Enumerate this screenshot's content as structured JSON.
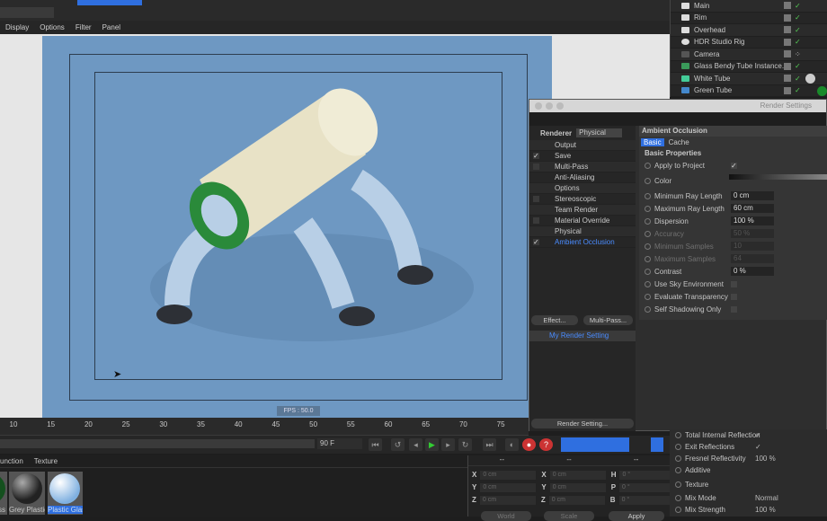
{
  "menubar": [
    "Display",
    "Options",
    "Filter",
    "Panel"
  ],
  "objects": [
    {
      "name": "Main",
      "check": true
    },
    {
      "name": "Rim",
      "check": true
    },
    {
      "name": "Overhead",
      "check": true
    },
    {
      "name": "HDR Studio Rig",
      "check": true
    },
    {
      "name": "Camera",
      "check": false
    },
    {
      "name": "Glass Bendy Tube Instance.1",
      "check": true
    },
    {
      "name": "White Tube",
      "check": true
    },
    {
      "name": "Green Tube",
      "check": true
    }
  ],
  "viewport": {
    "fps": "FPS : 50.0"
  },
  "render_settings": {
    "title": "Render Settings",
    "renderer_label": "Renderer",
    "renderer_value": "Physical",
    "items": [
      {
        "label": "Output",
        "checkbox": "",
        "selected": false
      },
      {
        "label": "Save",
        "checkbox": "✓",
        "selected": false
      },
      {
        "label": "Multi-Pass",
        "checkbox": " ",
        "selected": false
      },
      {
        "label": "Anti-Aliasing",
        "checkbox": "",
        "selected": false
      },
      {
        "label": "Options",
        "checkbox": "",
        "selected": false
      },
      {
        "label": "Stereoscopic",
        "checkbox": " ",
        "selected": false
      },
      {
        "label": "Team Render",
        "checkbox": "",
        "selected": false
      },
      {
        "label": "Material Override",
        "checkbox": " ",
        "selected": false
      },
      {
        "label": "Physical",
        "checkbox": "",
        "selected": false
      },
      {
        "label": "Ambient Occlusion",
        "checkbox": "✓",
        "selected": true
      }
    ],
    "effect_btn": "Effect...",
    "multipass_btn": "Multi-Pass...",
    "setting_name": "My Render Setting",
    "render_setting_btn": "Render Setting...",
    "section_title": "Ambient Occlusion",
    "tabs": [
      "Basic",
      "Cache"
    ],
    "group": "Basic Properties",
    "props": [
      {
        "label": "Apply to Project",
        "type": "check",
        "value": "✓",
        "dim": false
      },
      {
        "label": "Color",
        "type": "gradient",
        "value": "",
        "dim": false
      },
      {
        "label": "Minimum Ray Length",
        "type": "num",
        "value": "0 cm",
        "dim": false
      },
      {
        "label": "Maximum Ray Length",
        "type": "num",
        "value": "60 cm",
        "dim": false
      },
      {
        "label": "Dispersion",
        "type": "num",
        "value": "100 %",
        "dim": false
      },
      {
        "label": "Accuracy",
        "type": "num",
        "value": "50 %",
        "dim": true
      },
      {
        "label": "Minimum Samples",
        "type": "num",
        "value": "10",
        "dim": true
      },
      {
        "label": "Maximum Samples",
        "type": "num",
        "value": "64",
        "dim": true
      },
      {
        "label": "Contrast",
        "type": "num",
        "value": "0 %",
        "dim": false
      },
      {
        "label": "Use Sky Environment",
        "type": "check",
        "value": "",
        "dim": false
      },
      {
        "label": "Evaluate Transparency",
        "type": "check",
        "value": "",
        "dim": false
      },
      {
        "label": "Self Shadowing Only",
        "type": "check",
        "value": "",
        "dim": false
      }
    ]
  },
  "timeline": {
    "ticks": [
      "10",
      "15",
      "20",
      "25",
      "30",
      "35",
      "40",
      "45",
      "50",
      "55",
      "60",
      "65",
      "70",
      "75"
    ],
    "end_frame": "90 F"
  },
  "materials": {
    "tabs": [
      "unction",
      "Texture"
    ],
    "items": [
      {
        "name": "ss"
      },
      {
        "name": "Grey Plastic"
      },
      {
        "name": "Plastic Glass"
      }
    ]
  },
  "coords": {
    "headers": [
      "--",
      "--",
      "--"
    ],
    "rows": [
      [
        "X",
        "0 cm",
        "X",
        "0 cm",
        "H",
        "0 °"
      ],
      [
        "Y",
        "0 cm",
        "Y",
        "0 cm",
        "P",
        "0 °"
      ],
      [
        "Z",
        "0 cm",
        "Z",
        "0 cm",
        "B",
        "0 °"
      ]
    ],
    "buttons": [
      "World",
      "Scale",
      "Apply"
    ]
  },
  "attributes": [
    {
      "label": "Total Internal Reflection",
      "value": "✓"
    },
    {
      "label": "Exit Reflections",
      "value": "✓"
    },
    {
      "label": "Fresnel Reflectivity",
      "value": "100 %"
    },
    {
      "label": "Additive",
      "value": ""
    },
    {
      "label": "Texture",
      "value": ""
    },
    {
      "label": "Mix Mode",
      "value": "Normal"
    },
    {
      "label": "Mix Strength",
      "value": "100 %"
    }
  ]
}
